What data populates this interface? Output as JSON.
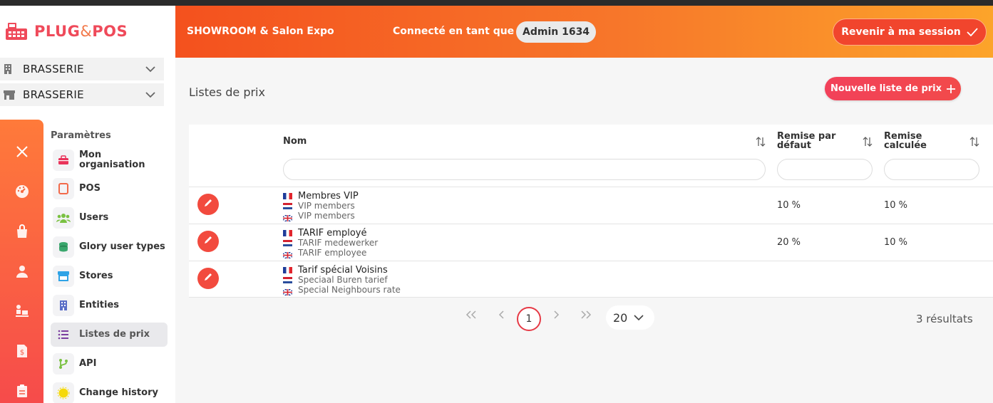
{
  "brand": {
    "word1": "PLUG",
    "amp": "&",
    "word2": "POS"
  },
  "selectors": [
    {
      "label": "BRASSERIE",
      "icon": "building-icon"
    },
    {
      "label": "BRASSERIE",
      "icon": "store-icon"
    }
  ],
  "rail_icons": [
    "close-icon",
    "dashboard-icon",
    "shopping-bag-icon",
    "user-icon",
    "delivery-icon",
    "price-tag-icon",
    "clipboard-icon"
  ],
  "menu": {
    "heading": "Paramètres",
    "items": [
      {
        "label": "Mon organisation",
        "icon": "briefcase-icon",
        "color": "#e9335a",
        "active": false
      },
      {
        "label": "POS",
        "icon": "tablet-icon",
        "color": "#f26a4a",
        "active": false
      },
      {
        "label": "Users",
        "icon": "users-icon",
        "color": "#7ac142",
        "active": false
      },
      {
        "label": "Glory user types",
        "icon": "coins-icon",
        "color": "#3aa76d",
        "active": false
      },
      {
        "label": "Stores",
        "icon": "storefront-icon",
        "color": "#2fa3e6",
        "active": false
      },
      {
        "label": "Entities",
        "icon": "building-icon",
        "color": "#5b6fc7",
        "active": false
      },
      {
        "label": "Listes de prix",
        "icon": "list-icon",
        "color": "#7b3fa0",
        "active": true
      },
      {
        "label": "API",
        "icon": "git-branch-icon",
        "color": "#7ac142",
        "active": false
      },
      {
        "label": "Change history",
        "icon": "sun-icon",
        "color": "#f5d90a",
        "active": false
      }
    ]
  },
  "header": {
    "shop": "SHOWROOM & Salon Expo",
    "connected_as": "Connecté en tant que",
    "user": "Admin 1634",
    "return_label": "Revenir à ma session"
  },
  "page": {
    "title": "Listes de prix",
    "new_button": "Nouvelle liste de prix"
  },
  "table": {
    "columns": [
      {
        "key": "name",
        "label": "Nom"
      },
      {
        "key": "default_discount",
        "label_line1": "Remise par",
        "label_line2": "défaut"
      },
      {
        "key": "computed_discount",
        "label_line1": "Remise",
        "label_line2": "calculée"
      }
    ],
    "rows": [
      {
        "fr": "Membres VIP",
        "nl": "VIP members",
        "en": "VIP members",
        "default": "10 %",
        "computed": "10 %"
      },
      {
        "fr": "TARIF employé",
        "nl": "TARIF medewerker",
        "en": "TARIF employee",
        "default": "20 %",
        "computed": "10 %"
      },
      {
        "fr": "Tarif spécial Voisins",
        "nl": "Speciaal Buren tarief",
        "en": "Special Neighbours rate",
        "default": "",
        "computed": ""
      }
    ]
  },
  "pagination": {
    "current": "1",
    "page_size": "20",
    "results": "3 résultats"
  },
  "colors": {
    "accent": "#f24a3e",
    "header_start": "#f4511e",
    "header_end": "#fca42a",
    "rail_start": "#ff7a3a",
    "rail_end": "#f64b4b"
  }
}
